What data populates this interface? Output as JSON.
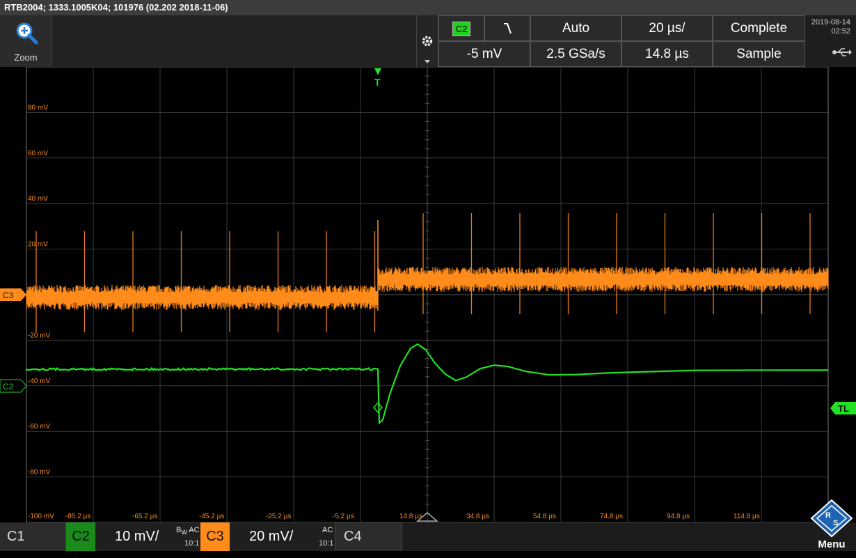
{
  "title": "RTB2004; 1333.1005K04; 101976 (02.202 2018-11-06)",
  "zoom": {
    "label": "Zoom",
    "icon": "zoom-in-icon"
  },
  "settings": {
    "icon": "gear-icon"
  },
  "trigger": {
    "source": "C2",
    "slope_icon": "falling-edge-icon",
    "mode": "Auto",
    "level": "-5 mV",
    "marker": "T"
  },
  "timebase": {
    "scale": "20 µs/",
    "sample_rate": "2.5 GSa/s",
    "position": "14.8 µs"
  },
  "acquisition": {
    "state": "Complete",
    "mode": "Sample"
  },
  "datetime": {
    "date": "2019-08-14",
    "time": "02:52"
  },
  "usb_icon": "usb-icon",
  "grid": {
    "y_labels": [
      "80 mV",
      "60 mV",
      "40 mV",
      "20 mV",
      "-20 mV",
      "-40 mV",
      "-60 mV",
      "-80 mV",
      "-100 mV"
    ],
    "x_labels": [
      "-85.2 µs",
      "-65.2 µs",
      "-45.2 µs",
      "-25.2 µs",
      "-5.2 µs",
      "14.8 µs",
      "34.8 µs",
      "54.8 µs",
      "74.8 µs",
      "94.8 µs",
      "114.8 µs"
    ]
  },
  "markers": {
    "c3": "C3",
    "c2": "C2",
    "tl": "TL"
  },
  "channels": [
    {
      "name": "C1"
    },
    {
      "name": "C2",
      "scale": "10 mV/",
      "coupling": "AC",
      "bw": "B",
      "bw_sub": "W",
      "probe": "10:1",
      "color": "#22d022"
    },
    {
      "name": "C3",
      "scale": "20 mV/",
      "coupling": "AC",
      "probe": "10:1",
      "color": "#ff8c1a"
    },
    {
      "name": "C4"
    }
  ],
  "menu": {
    "label": "Menu",
    "logo": "rs-logo"
  },
  "colors": {
    "c3": "#ff8c1a",
    "c2": "#22e022",
    "grid": "#3a3a3a"
  }
}
